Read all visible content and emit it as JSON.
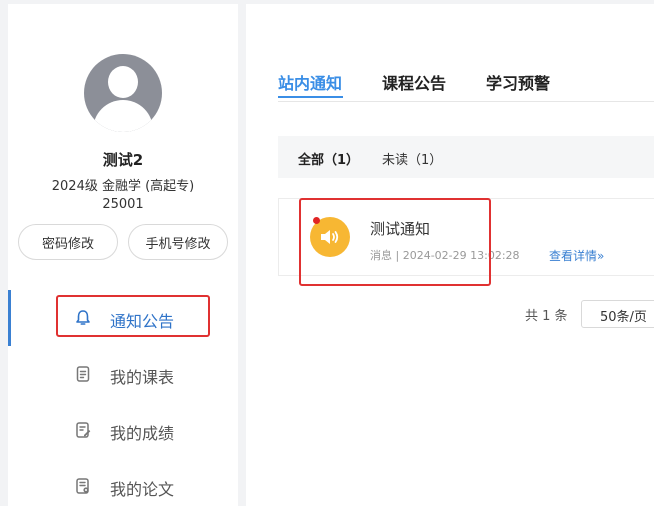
{
  "user": {
    "name": "测试2",
    "class": "2024级 金融学 (高起专)",
    "id": "25001"
  },
  "buttons": {
    "password": "密码修改",
    "phone": "手机号修改"
  },
  "nav": {
    "items": [
      {
        "label": "通知公告",
        "icon": "bell-icon",
        "active": true
      },
      {
        "label": "我的课表",
        "icon": "document-icon",
        "active": false
      },
      {
        "label": "我的成绩",
        "icon": "edit-document-icon",
        "active": false
      },
      {
        "label": "我的论文",
        "icon": "paper-icon",
        "active": false
      }
    ]
  },
  "tabs": [
    {
      "label": "站内通知",
      "active": true
    },
    {
      "label": "课程公告",
      "active": false
    },
    {
      "label": "学习预警",
      "active": false
    }
  ],
  "filters": {
    "all": "全部（1）",
    "unread": "未读（1）"
  },
  "notice": {
    "title": "测试通知",
    "meta": "消息 | 2024-02-29 13:02:28",
    "detail": "查看详情»",
    "icon": "speaker-icon",
    "unread": true
  },
  "pager": {
    "total": "共 1 条",
    "size": "50条/页"
  },
  "colors": {
    "accent": "#3a8ee6",
    "highlight": "#e03131",
    "notice_icon": "#f7b733"
  }
}
